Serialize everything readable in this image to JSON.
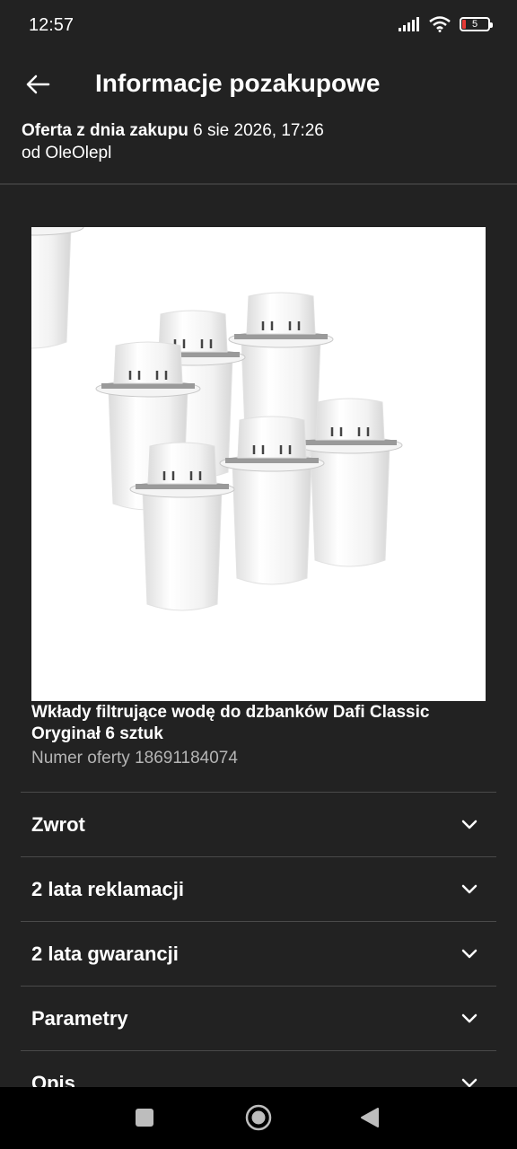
{
  "status_bar": {
    "time": "12:57",
    "battery_level": "5",
    "icons": [
      "signal-icon",
      "wifi-icon",
      "battery-icon"
    ]
  },
  "header": {
    "title": "Informacje pozakupowe",
    "back_icon": "arrow-left-icon"
  },
  "offer": {
    "date_label": "Oferta z dnia zakupu",
    "date_value": "6 sie 2026, 17:26",
    "seller": "od OleOlepl"
  },
  "product": {
    "title": "Wkłady filtrujące wodę do dzbanków Dafi Classic Oryginał 6 sztuk",
    "offer_number": "Numer oferty 18691184074",
    "image_description": "six white water filter cartridges"
  },
  "accordion": {
    "items": [
      {
        "label": "Zwrot"
      },
      {
        "label": "2 lata reklamacji"
      },
      {
        "label": "2 lata gwarancji"
      },
      {
        "label": "Parametry"
      },
      {
        "label": "Opis"
      }
    ]
  },
  "colors": {
    "background": "#222222",
    "text": "#ffffff",
    "muted_text": "#b5b5b5",
    "divider": "#4a4a4a",
    "battery_low": "#e53935"
  }
}
